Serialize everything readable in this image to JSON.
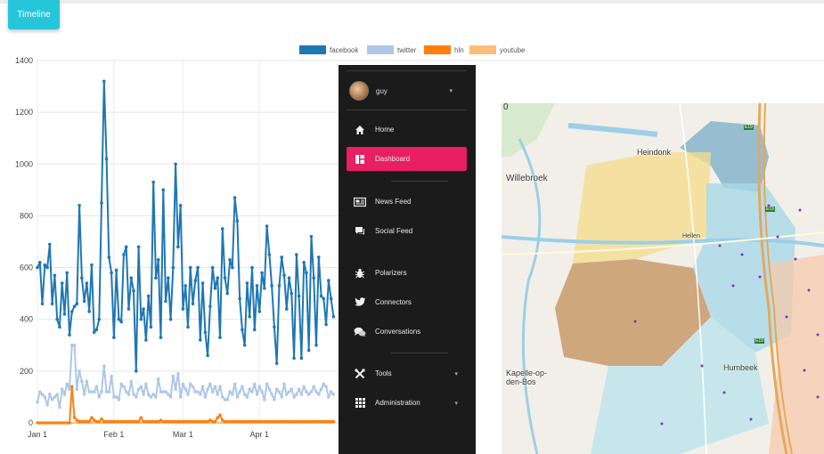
{
  "timeline_button": "Timeline",
  "legend": [
    {
      "name": "facebook",
      "color": "#1f77b4"
    },
    {
      "name": "twitter",
      "color": "#aec7e8"
    },
    {
      "name": "hln",
      "color": "#ff7f0e"
    },
    {
      "name": "youtube",
      "color": "#ffbb78"
    }
  ],
  "chart_data": {
    "type": "line",
    "ylim": [
      0,
      1400
    ],
    "y_ticks": [
      "0",
      "200",
      "400",
      "600",
      "800",
      "1000",
      "1200",
      "1400"
    ],
    "x_ticks": [
      "Jan 1",
      "Feb 1",
      "Mar 1",
      "Apr 1"
    ],
    "grid": true,
    "legend_position": "top-center",
    "x": [
      "01-01",
      "01-02",
      "01-03",
      "01-04",
      "01-05",
      "01-06",
      "01-07",
      "01-08",
      "01-09",
      "01-10",
      "01-11",
      "01-12",
      "01-13",
      "01-14",
      "01-15",
      "01-16",
      "01-17",
      "01-18",
      "01-19",
      "01-20",
      "01-21",
      "01-22",
      "01-23",
      "01-24",
      "01-25",
      "01-26",
      "01-27",
      "01-28",
      "01-29",
      "01-30",
      "01-31",
      "02-01",
      "02-02",
      "02-03",
      "02-04",
      "02-05",
      "02-06",
      "02-07",
      "02-08",
      "02-09",
      "02-10",
      "02-11",
      "02-12",
      "02-13",
      "02-14",
      "02-15",
      "02-16",
      "02-17",
      "02-18",
      "02-19",
      "02-20",
      "02-21",
      "02-22",
      "02-23",
      "02-24",
      "02-25",
      "02-26",
      "02-27",
      "02-28",
      "03-01",
      "03-02",
      "03-03",
      "03-04",
      "03-05",
      "03-06",
      "03-07",
      "03-08",
      "03-09",
      "03-10",
      "03-11",
      "03-12",
      "03-13",
      "03-14",
      "03-15",
      "03-16",
      "03-17",
      "03-18",
      "03-19",
      "03-20",
      "03-21",
      "03-22",
      "03-23",
      "03-24",
      "03-25",
      "03-26",
      "03-27",
      "03-28",
      "03-29",
      "03-30",
      "03-31",
      "04-01",
      "04-02",
      "04-03",
      "04-04",
      "04-05",
      "04-06",
      "04-07",
      "04-08",
      "04-09",
      "04-10",
      "04-11",
      "04-12",
      "04-13",
      "04-14",
      "04-15",
      "04-16",
      "04-17",
      "04-18",
      "04-19",
      "04-20",
      "04-21",
      "04-22",
      "04-23",
      "04-24",
      "04-25",
      "04-26",
      "04-27",
      "04-28",
      "04-29",
      "04-30",
      "05-01"
    ],
    "series": [
      {
        "name": "facebook",
        "values": [
          600,
          620,
          460,
          610,
          600,
          690,
          460,
          570,
          400,
          370,
          540,
          420,
          580,
          340,
          430,
          450,
          460,
          840,
          560,
          470,
          540,
          430,
          610,
          350,
          360,
          400,
          850,
          1320,
          1020,
          640,
          580,
          330,
          590,
          400,
          390,
          650,
          680,
          440,
          560,
          510,
          200,
          680,
          400,
          440,
          320,
          490,
          370,
          930,
          560,
          630,
          330,
          900,
          470,
          560,
          400,
          600,
          1000,
          680,
          840,
          440,
          530,
          370,
          600,
          460,
          550,
          600,
          320,
          540,
          350,
          260,
          450,
          600,
          520,
          560,
          330,
          750,
          560,
          500,
          630,
          600,
          870,
          780,
          480,
          360,
          300,
          540,
          410,
          600,
          360,
          530,
          430,
          580,
          520,
          760,
          650,
          530,
          370,
          230,
          530,
          640,
          570,
          440,
          560,
          500,
          250,
          650,
          490,
          250,
          620,
          580,
          280,
          720,
          560,
          300,
          640,
          490,
          480,
          380,
          550,
          480,
          410
        ]
      },
      {
        "name": "twitter",
        "values": [
          80,
          120,
          110,
          100,
          70,
          110,
          90,
          100,
          110,
          60,
          130,
          110,
          150,
          130,
          300,
          300,
          130,
          200,
          160,
          110,
          160,
          120,
          120,
          120,
          140,
          100,
          120,
          220,
          120,
          120,
          180,
          100,
          100,
          90,
          150,
          140,
          120,
          110,
          160,
          110,
          100,
          130,
          140,
          110,
          150,
          110,
          100,
          110,
          100,
          170,
          120,
          120,
          120,
          110,
          100,
          180,
          130,
          190,
          100,
          150,
          130,
          110,
          150,
          140,
          120,
          120,
          110,
          140,
          100,
          130,
          150,
          120,
          140,
          110,
          140,
          100,
          90,
          90,
          120,
          110,
          150,
          100,
          120,
          140,
          110,
          100,
          130,
          120,
          150,
          110,
          140,
          120,
          90,
          150,
          130,
          110,
          90,
          130,
          120,
          100,
          150,
          110,
          120,
          130,
          100,
          110,
          130,
          110,
          140,
          120,
          110,
          120,
          140,
          120,
          110,
          130,
          150,
          140,
          100,
          120,
          110
        ]
      },
      {
        "name": "hln",
        "values": [
          0,
          0,
          0,
          0,
          0,
          0,
          0,
          0,
          0,
          0,
          0,
          0,
          0,
          0,
          140,
          20,
          10,
          5,
          5,
          5,
          5,
          5,
          20,
          10,
          5,
          5,
          15,
          5,
          5,
          5,
          5,
          5,
          5,
          5,
          5,
          5,
          5,
          5,
          5,
          5,
          5,
          5,
          20,
          5,
          5,
          5,
          5,
          5,
          5,
          5,
          10,
          5,
          5,
          5,
          5,
          5,
          5,
          5,
          5,
          5,
          5,
          5,
          5,
          5,
          5,
          5,
          5,
          5,
          5,
          5,
          10,
          5,
          5,
          20,
          30,
          10,
          5,
          5,
          5,
          5,
          5,
          5,
          5,
          5,
          5,
          5,
          5,
          5,
          5,
          5,
          5,
          5,
          5,
          5,
          5,
          5,
          5,
          5,
          5,
          5,
          5,
          5,
          5,
          5,
          5,
          5,
          5,
          5,
          5,
          5,
          5,
          5,
          5,
          5,
          5,
          5,
          5,
          5,
          5,
          5,
          5
        ]
      },
      {
        "name": "youtube",
        "values": [
          0,
          0,
          0,
          0,
          0,
          0,
          0,
          0,
          0,
          0,
          0,
          0,
          0,
          0,
          0,
          0,
          0,
          0,
          0,
          0,
          0,
          0,
          0,
          0,
          0,
          0,
          0,
          0,
          0,
          0,
          0,
          0,
          0,
          0,
          0,
          0,
          0,
          0,
          0,
          0,
          0,
          0,
          0,
          0,
          0,
          0,
          0,
          0,
          0,
          0,
          0,
          0,
          0,
          0,
          0,
          0,
          0,
          0,
          0,
          0,
          0,
          0,
          0,
          0,
          0,
          0,
          0,
          0,
          0,
          0,
          0,
          0,
          0,
          0,
          0,
          0,
          0,
          0,
          0,
          0,
          0,
          0,
          0,
          0,
          0,
          0,
          0,
          0,
          0,
          0,
          0,
          0,
          0,
          0,
          0,
          0,
          0,
          0,
          0,
          0,
          0,
          0,
          0,
          0,
          0,
          0,
          0,
          0,
          0,
          0,
          0,
          0,
          0,
          0,
          0,
          0,
          0,
          0,
          0,
          0,
          0
        ]
      }
    ]
  },
  "sidebar": {
    "user": "guy",
    "items": [
      {
        "label": "Home",
        "icon": "home-icon",
        "active": false,
        "caret": false
      },
      {
        "label": "Dashboard",
        "icon": "dashboard-icon",
        "active": true,
        "caret": false
      },
      {
        "label": "News Feed",
        "icon": "newspaper-icon",
        "active": false,
        "caret": false
      },
      {
        "label": "Social Feed",
        "icon": "chat-icon",
        "active": false,
        "caret": false
      },
      {
        "label": "Polarizers",
        "icon": "bug-icon",
        "active": false,
        "caret": false
      },
      {
        "label": "Connectors",
        "icon": "twitter-bird-icon",
        "active": false,
        "caret": false
      },
      {
        "label": "Conversations",
        "icon": "conversation-icon",
        "active": false,
        "caret": false
      },
      {
        "label": "Tools",
        "icon": "tools-icon",
        "active": false,
        "caret": true
      },
      {
        "label": "Administration",
        "icon": "grid-icon",
        "active": false,
        "caret": true
      }
    ]
  },
  "map": {
    "places": [
      "Heindonk",
      "Willebroek",
      "Hellen",
      "Kapelle-op-den-Bos",
      "Humbeek"
    ],
    "road_labels": [
      "E19",
      "E19",
      "E19"
    ],
    "corner_label": "0"
  }
}
